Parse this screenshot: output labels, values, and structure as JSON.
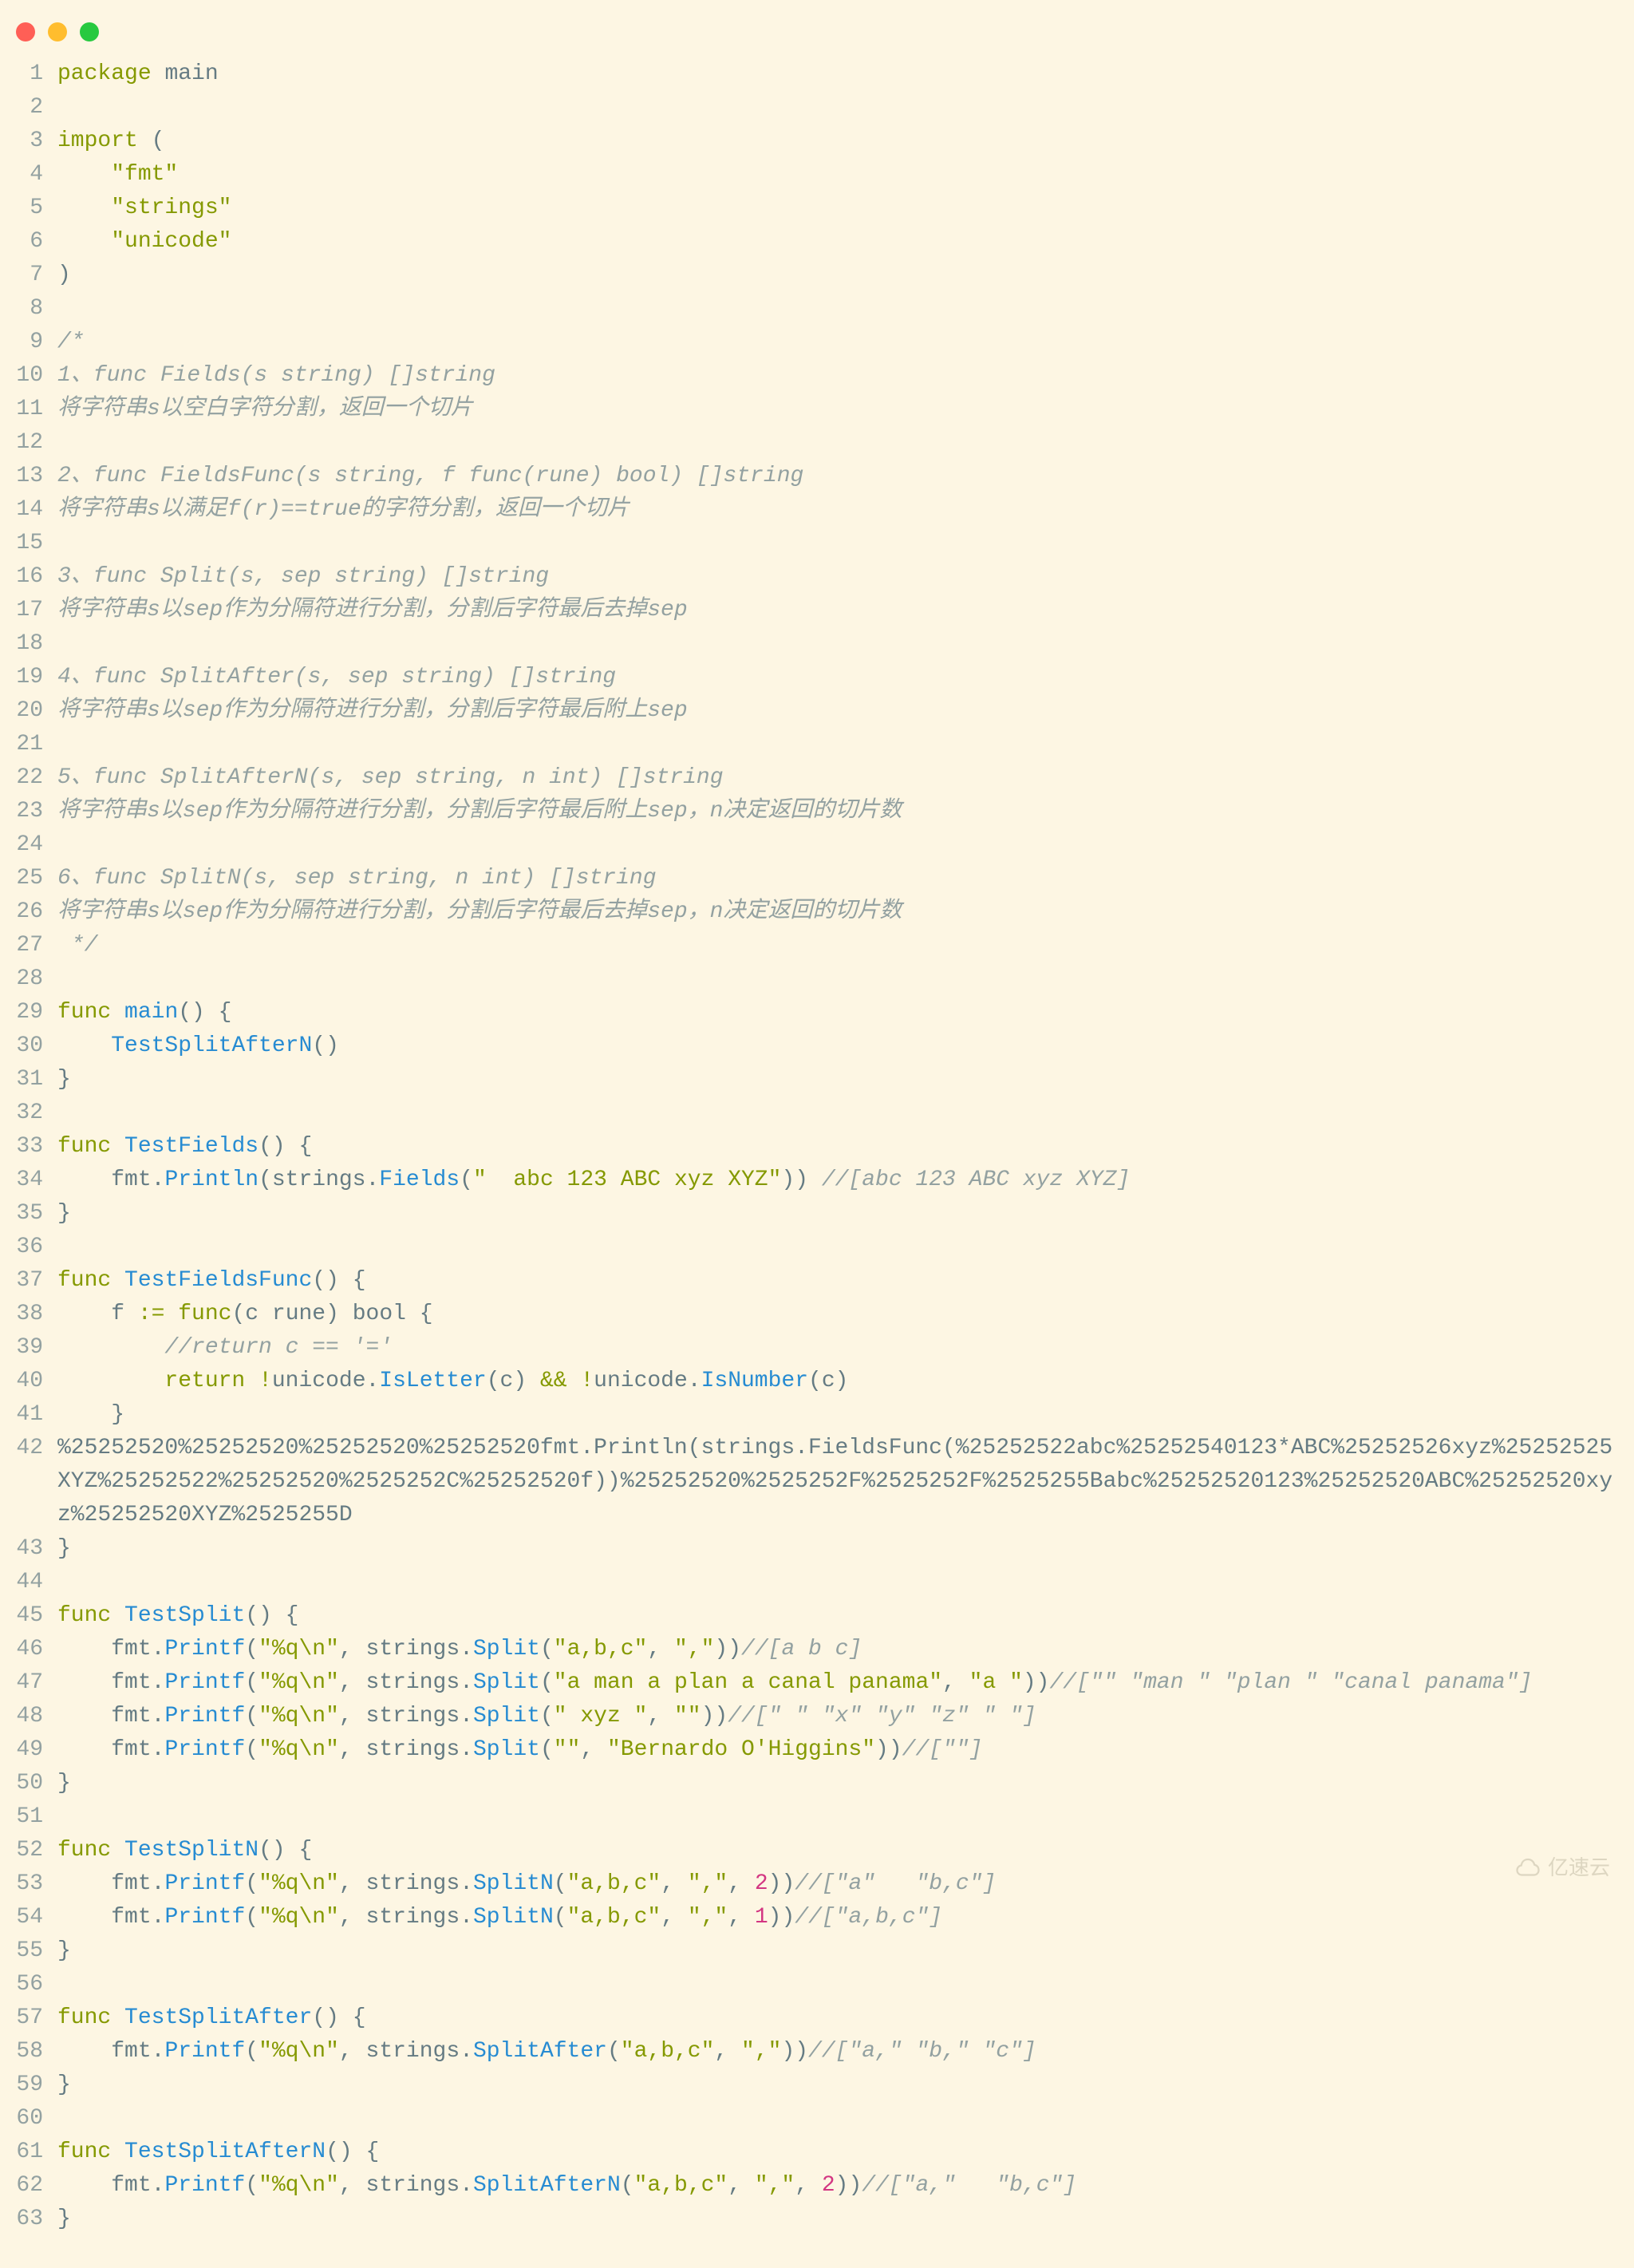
{
  "window": {
    "traffic_lights": [
      "close",
      "minimize",
      "zoom"
    ]
  },
  "watermark": "亿速云",
  "code_lines": [
    {
      "n": 1,
      "tokens": [
        [
          "kw",
          "package"
        ],
        [
          "plain",
          " "
        ],
        [
          "id",
          "main"
        ]
      ]
    },
    {
      "n": 2,
      "tokens": []
    },
    {
      "n": 3,
      "tokens": [
        [
          "kw",
          "import"
        ],
        [
          "plain",
          " ("
        ]
      ]
    },
    {
      "n": 4,
      "tokens": [
        [
          "plain",
          "    "
        ],
        [
          "str",
          "\"fmt\""
        ]
      ]
    },
    {
      "n": 5,
      "tokens": [
        [
          "plain",
          "    "
        ],
        [
          "str",
          "\"strings\""
        ]
      ]
    },
    {
      "n": 6,
      "tokens": [
        [
          "plain",
          "    "
        ],
        [
          "str",
          "\"unicode\""
        ]
      ]
    },
    {
      "n": 7,
      "tokens": [
        [
          "plain",
          ")"
        ]
      ]
    },
    {
      "n": 8,
      "tokens": []
    },
    {
      "n": 9,
      "tokens": [
        [
          "cmt",
          "/*"
        ]
      ]
    },
    {
      "n": 10,
      "tokens": [
        [
          "cmt",
          "1、func Fields(s string) []string"
        ]
      ]
    },
    {
      "n": 11,
      "tokens": [
        [
          "cmt",
          "将字符串s以空白字符分割，返回一个切片"
        ]
      ]
    },
    {
      "n": 12,
      "tokens": []
    },
    {
      "n": 13,
      "tokens": [
        [
          "cmt",
          "2、func FieldsFunc(s string, f func(rune) bool) []string"
        ]
      ]
    },
    {
      "n": 14,
      "tokens": [
        [
          "cmt",
          "将字符串s以满足f(r)==true的字符分割，返回一个切片"
        ]
      ]
    },
    {
      "n": 15,
      "tokens": []
    },
    {
      "n": 16,
      "tokens": [
        [
          "cmt",
          "3、func Split(s, sep string) []string"
        ]
      ]
    },
    {
      "n": 17,
      "tokens": [
        [
          "cmt",
          "将字符串s以sep作为分隔符进行分割，分割后字符最后去掉sep"
        ]
      ]
    },
    {
      "n": 18,
      "tokens": []
    },
    {
      "n": 19,
      "tokens": [
        [
          "cmt",
          "4、func SplitAfter(s, sep string) []string"
        ]
      ]
    },
    {
      "n": 20,
      "tokens": [
        [
          "cmt",
          "将字符串s以sep作为分隔符进行分割，分割后字符最后附上sep"
        ]
      ]
    },
    {
      "n": 21,
      "tokens": []
    },
    {
      "n": 22,
      "tokens": [
        [
          "cmt",
          "5、func SplitAfterN(s, sep string, n int) []string"
        ]
      ]
    },
    {
      "n": 23,
      "tokens": [
        [
          "cmt",
          "将字符串s以sep作为分隔符进行分割，分割后字符最后附上sep，n决定返回的切片数"
        ]
      ]
    },
    {
      "n": 24,
      "tokens": []
    },
    {
      "n": 25,
      "tokens": [
        [
          "cmt",
          "6、func SplitN(s, sep string, n int) []string"
        ]
      ]
    },
    {
      "n": 26,
      "tokens": [
        [
          "cmt",
          "将字符串s以sep作为分隔符进行分割，分割后字符最后去掉sep，n决定返回的切片数"
        ]
      ]
    },
    {
      "n": 27,
      "tokens": [
        [
          "cmt",
          " */"
        ]
      ]
    },
    {
      "n": 28,
      "tokens": []
    },
    {
      "n": 29,
      "tokens": [
        [
          "kw",
          "func"
        ],
        [
          "plain",
          " "
        ],
        [
          "fn",
          "main"
        ],
        [
          "plain",
          "() {"
        ]
      ]
    },
    {
      "n": 30,
      "tokens": [
        [
          "plain",
          "    "
        ],
        [
          "fn",
          "TestSplitAfterN"
        ],
        [
          "plain",
          "()"
        ]
      ]
    },
    {
      "n": 31,
      "tokens": [
        [
          "plain",
          "}"
        ]
      ]
    },
    {
      "n": 32,
      "tokens": []
    },
    {
      "n": 33,
      "tokens": [
        [
          "kw",
          "func"
        ],
        [
          "plain",
          " "
        ],
        [
          "fn",
          "TestFields"
        ],
        [
          "plain",
          "() {"
        ]
      ]
    },
    {
      "n": 34,
      "tokens": [
        [
          "plain",
          "    fmt."
        ],
        [
          "fn",
          "Println"
        ],
        [
          "plain",
          "(strings."
        ],
        [
          "fn",
          "Fields"
        ],
        [
          "plain",
          "("
        ],
        [
          "str",
          "\"  abc 123 ABC xyz XYZ\""
        ],
        [
          "plain",
          ")) "
        ],
        [
          "cmt",
          "//[abc 123 ABC xyz XYZ]"
        ]
      ]
    },
    {
      "n": 35,
      "tokens": [
        [
          "plain",
          "}"
        ]
      ]
    },
    {
      "n": 36,
      "tokens": []
    },
    {
      "n": 37,
      "tokens": [
        [
          "kw",
          "func"
        ],
        [
          "plain",
          " "
        ],
        [
          "fn",
          "TestFieldsFunc"
        ],
        [
          "plain",
          "() {"
        ]
      ]
    },
    {
      "n": 38,
      "tokens": [
        [
          "plain",
          "    f "
        ],
        [
          "op",
          ":="
        ],
        [
          "plain",
          " "
        ],
        [
          "kw",
          "func"
        ],
        [
          "plain",
          "(c "
        ],
        [
          "id",
          "rune"
        ],
        [
          "plain",
          ") "
        ],
        [
          "id",
          "bool"
        ],
        [
          "plain",
          " {"
        ]
      ]
    },
    {
      "n": 39,
      "tokens": [
        [
          "plain",
          "        "
        ],
        [
          "cmt",
          "//return c == '='"
        ]
      ]
    },
    {
      "n": 40,
      "tokens": [
        [
          "plain",
          "        "
        ],
        [
          "kw",
          "return"
        ],
        [
          "plain",
          " "
        ],
        [
          "op",
          "!"
        ],
        [
          "plain",
          "unicode."
        ],
        [
          "fn",
          "IsLetter"
        ],
        [
          "plain",
          "(c) "
        ],
        [
          "op",
          "&&"
        ],
        [
          "plain",
          " "
        ],
        [
          "op",
          "!"
        ],
        [
          "plain",
          "unicode."
        ],
        [
          "fn",
          "IsNumber"
        ],
        [
          "plain",
          "(c)"
        ]
      ]
    },
    {
      "n": 41,
      "tokens": [
        [
          "plain",
          "    }"
        ]
      ]
    },
    {
      "n": 42,
      "tokens": [
        [
          "plain",
          "%25252520%25252520%25252520%25252520fmt.Println(strings.FieldsFunc(%25252522abc%25252540123*ABC%25252526xyz%25252525XYZ%25252522%25252520%2525252C%25252520f))%25252520%2525252F%2525252F%2525255Babc%25252520123%25252520ABC%25252520xyz%25252520XYZ%2525255D"
        ]
      ]
    },
    {
      "n": 43,
      "tokens": [
        [
          "plain",
          "}"
        ]
      ]
    },
    {
      "n": 44,
      "tokens": []
    },
    {
      "n": 45,
      "tokens": [
        [
          "kw",
          "func"
        ],
        [
          "plain",
          " "
        ],
        [
          "fn",
          "TestSplit"
        ],
        [
          "plain",
          "() {"
        ]
      ]
    },
    {
      "n": 46,
      "tokens": [
        [
          "plain",
          "    fmt."
        ],
        [
          "fn",
          "Printf"
        ],
        [
          "plain",
          "("
        ],
        [
          "str",
          "\"%q\\n\""
        ],
        [
          "plain",
          ", strings."
        ],
        [
          "fn",
          "Split"
        ],
        [
          "plain",
          "("
        ],
        [
          "str",
          "\"a,b,c\""
        ],
        [
          "plain",
          ", "
        ],
        [
          "str",
          "\",\""
        ],
        [
          "plain",
          "))"
        ],
        [
          "cmt",
          "//[a b c]"
        ]
      ]
    },
    {
      "n": 47,
      "tokens": [
        [
          "plain",
          "    fmt."
        ],
        [
          "fn",
          "Printf"
        ],
        [
          "plain",
          "("
        ],
        [
          "str",
          "\"%q\\n\""
        ],
        [
          "plain",
          ", strings."
        ],
        [
          "fn",
          "Split"
        ],
        [
          "plain",
          "("
        ],
        [
          "str",
          "\"a man a plan a canal panama\""
        ],
        [
          "plain",
          ", "
        ],
        [
          "str",
          "\"a \""
        ],
        [
          "plain",
          "))"
        ],
        [
          "cmt",
          "//[\"\" \"man \" \"plan \" \"canal panama\"]"
        ]
      ]
    },
    {
      "n": 48,
      "tokens": [
        [
          "plain",
          "    fmt."
        ],
        [
          "fn",
          "Printf"
        ],
        [
          "plain",
          "("
        ],
        [
          "str",
          "\"%q\\n\""
        ],
        [
          "plain",
          ", strings."
        ],
        [
          "fn",
          "Split"
        ],
        [
          "plain",
          "("
        ],
        [
          "str",
          "\" xyz \""
        ],
        [
          "plain",
          ", "
        ],
        [
          "str",
          "\"\""
        ],
        [
          "plain",
          "))"
        ],
        [
          "cmt",
          "//[\" \" \"x\" \"y\" \"z\" \" \"]"
        ]
      ]
    },
    {
      "n": 49,
      "tokens": [
        [
          "plain",
          "    fmt."
        ],
        [
          "fn",
          "Printf"
        ],
        [
          "plain",
          "("
        ],
        [
          "str",
          "\"%q\\n\""
        ],
        [
          "plain",
          ", strings."
        ],
        [
          "fn",
          "Split"
        ],
        [
          "plain",
          "("
        ],
        [
          "str",
          "\"\""
        ],
        [
          "plain",
          ", "
        ],
        [
          "str",
          "\"Bernardo O'Higgins\""
        ],
        [
          "plain",
          "))"
        ],
        [
          "cmt",
          "//[\"\"]"
        ]
      ]
    },
    {
      "n": 50,
      "tokens": [
        [
          "plain",
          "}"
        ]
      ]
    },
    {
      "n": 51,
      "tokens": []
    },
    {
      "n": 52,
      "tokens": [
        [
          "kw",
          "func"
        ],
        [
          "plain",
          " "
        ],
        [
          "fn",
          "TestSplitN"
        ],
        [
          "plain",
          "() {"
        ]
      ]
    },
    {
      "n": 53,
      "tokens": [
        [
          "plain",
          "    fmt."
        ],
        [
          "fn",
          "Printf"
        ],
        [
          "plain",
          "("
        ],
        [
          "str",
          "\"%q\\n\""
        ],
        [
          "plain",
          ", strings."
        ],
        [
          "fn",
          "SplitN"
        ],
        [
          "plain",
          "("
        ],
        [
          "str",
          "\"a,b,c\""
        ],
        [
          "plain",
          ", "
        ],
        [
          "str",
          "\",\""
        ],
        [
          "plain",
          ", "
        ],
        [
          "num",
          "2"
        ],
        [
          "plain",
          "))"
        ],
        [
          "cmt",
          "//[\"a\"   \"b,c\"]"
        ]
      ]
    },
    {
      "n": 54,
      "tokens": [
        [
          "plain",
          "    fmt."
        ],
        [
          "fn",
          "Printf"
        ],
        [
          "plain",
          "("
        ],
        [
          "str",
          "\"%q\\n\""
        ],
        [
          "plain",
          ", strings."
        ],
        [
          "fn",
          "SplitN"
        ],
        [
          "plain",
          "("
        ],
        [
          "str",
          "\"a,b,c\""
        ],
        [
          "plain",
          ", "
        ],
        [
          "str",
          "\",\""
        ],
        [
          "plain",
          ", "
        ],
        [
          "num",
          "1"
        ],
        [
          "plain",
          "))"
        ],
        [
          "cmt",
          "//[\"a,b,c\"]"
        ]
      ]
    },
    {
      "n": 55,
      "tokens": [
        [
          "plain",
          "}"
        ]
      ]
    },
    {
      "n": 56,
      "tokens": []
    },
    {
      "n": 57,
      "tokens": [
        [
          "kw",
          "func"
        ],
        [
          "plain",
          " "
        ],
        [
          "fn",
          "TestSplitAfter"
        ],
        [
          "plain",
          "() {"
        ]
      ]
    },
    {
      "n": 58,
      "tokens": [
        [
          "plain",
          "    fmt."
        ],
        [
          "fn",
          "Printf"
        ],
        [
          "plain",
          "("
        ],
        [
          "str",
          "\"%q\\n\""
        ],
        [
          "plain",
          ", strings."
        ],
        [
          "fn",
          "SplitAfter"
        ],
        [
          "plain",
          "("
        ],
        [
          "str",
          "\"a,b,c\""
        ],
        [
          "plain",
          ", "
        ],
        [
          "str",
          "\",\""
        ],
        [
          "plain",
          "))"
        ],
        [
          "cmt",
          "//[\"a,\" \"b,\" \"c\"]"
        ]
      ]
    },
    {
      "n": 59,
      "tokens": [
        [
          "plain",
          "}"
        ]
      ]
    },
    {
      "n": 60,
      "tokens": []
    },
    {
      "n": 61,
      "tokens": [
        [
          "kw",
          "func"
        ],
        [
          "plain",
          " "
        ],
        [
          "fn",
          "TestSplitAfterN"
        ],
        [
          "plain",
          "() {"
        ]
      ]
    },
    {
      "n": 62,
      "tokens": [
        [
          "plain",
          "    fmt."
        ],
        [
          "fn",
          "Printf"
        ],
        [
          "plain",
          "("
        ],
        [
          "str",
          "\"%q\\n\""
        ],
        [
          "plain",
          ", strings."
        ],
        [
          "fn",
          "SplitAfterN"
        ],
        [
          "plain",
          "("
        ],
        [
          "str",
          "\"a,b,c\""
        ],
        [
          "plain",
          ", "
        ],
        [
          "str",
          "\",\""
        ],
        [
          "plain",
          ", "
        ],
        [
          "num",
          "2"
        ],
        [
          "plain",
          "))"
        ],
        [
          "cmt",
          "//[\"a,\"   \"b,c\"]"
        ]
      ]
    },
    {
      "n": 63,
      "tokens": [
        [
          "plain",
          "}"
        ]
      ]
    }
  ]
}
